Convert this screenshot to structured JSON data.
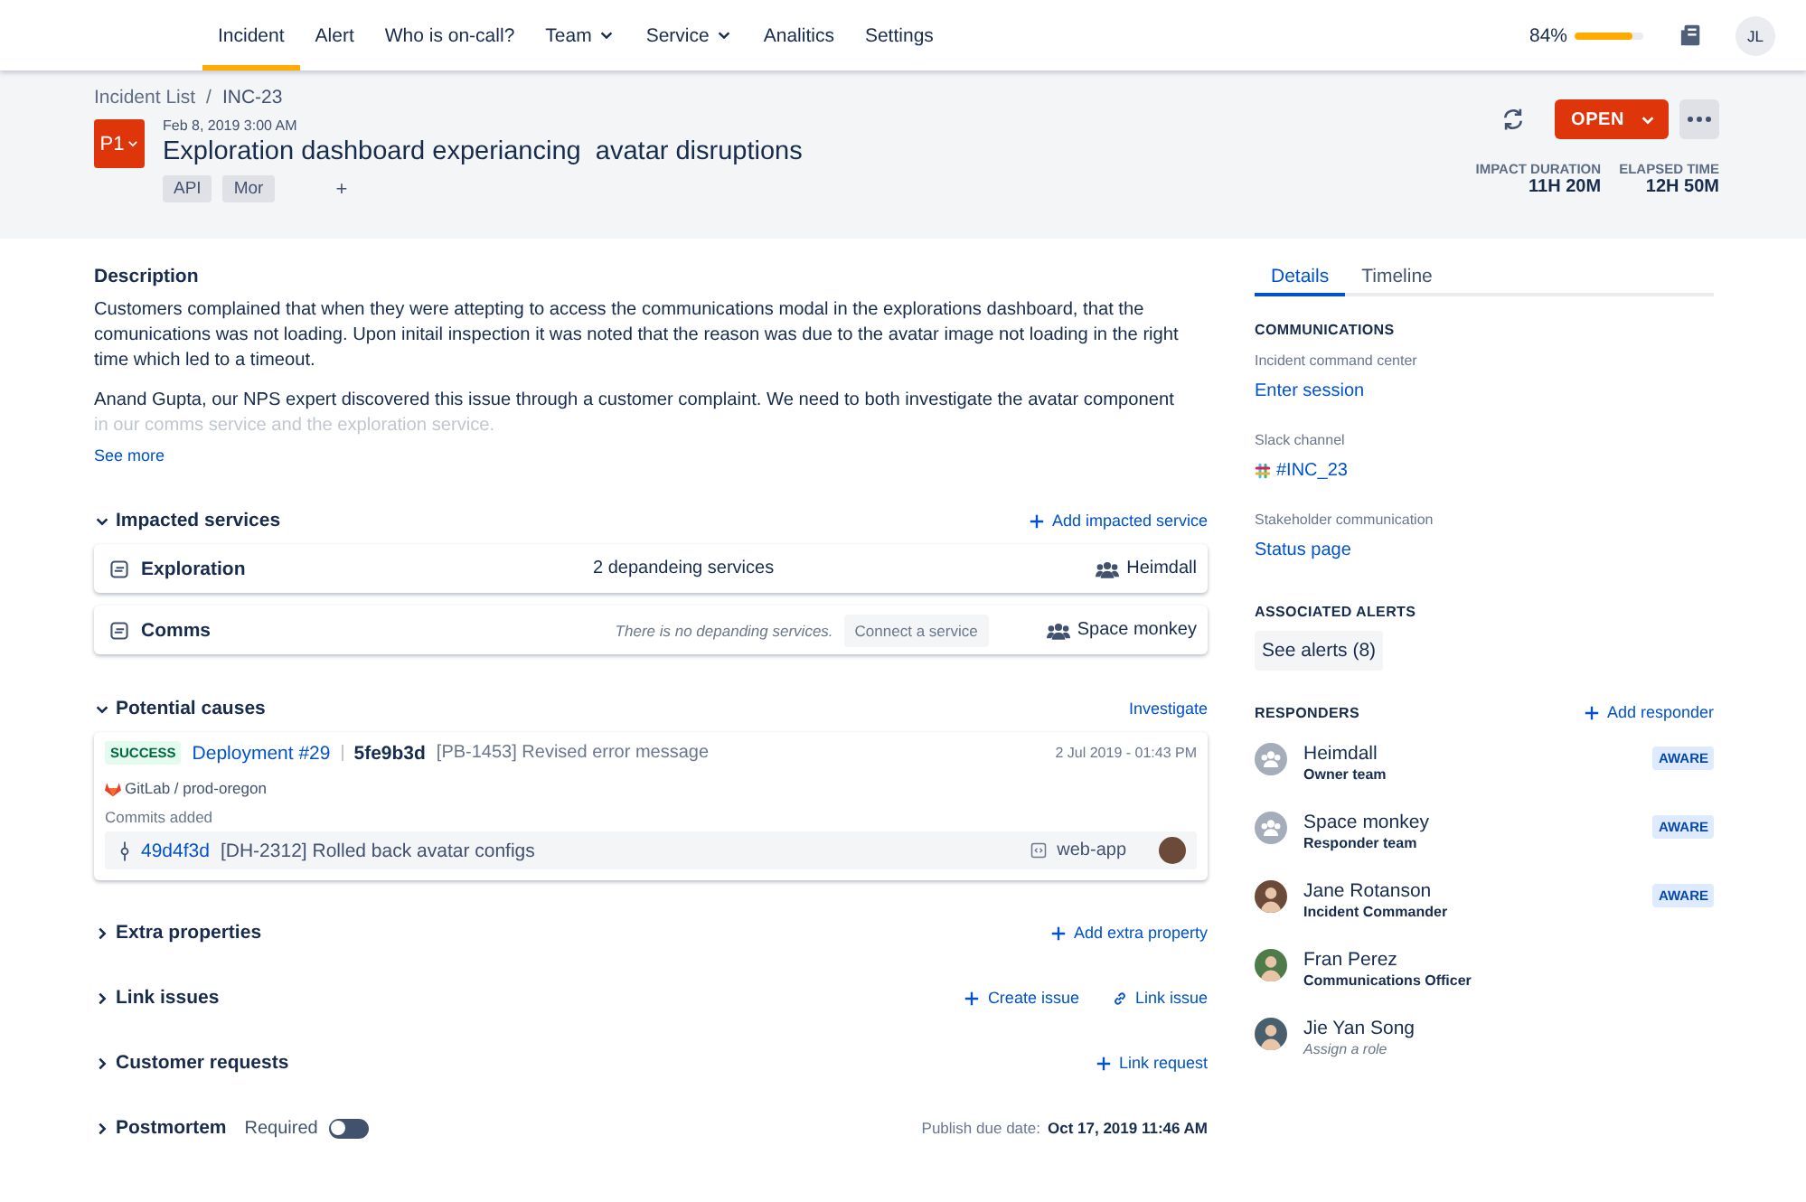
{
  "nav": {
    "items": [
      {
        "label": "Incident",
        "selected": true,
        "dropdown": false
      },
      {
        "label": "Alert",
        "selected": false,
        "dropdown": false
      },
      {
        "label": "Who is on-call?",
        "selected": false,
        "dropdown": false
      },
      {
        "label": "Team",
        "selected": false,
        "dropdown": true
      },
      {
        "label": "Service",
        "selected": false,
        "dropdown": true
      },
      {
        "label": "Analitics",
        "selected": false,
        "dropdown": false
      },
      {
        "label": "Settings",
        "selected": false,
        "dropdown": false
      }
    ],
    "usage": {
      "reading": "84%",
      "level": 0.84
    },
    "user_initials": "JL"
  },
  "header": {
    "breadcrumb": [
      "Incident List",
      "/",
      "INC-23"
    ],
    "priority": "P1",
    "date": "Feb 8, 2019 3:00 AM",
    "title": "Exploration dashboard experiancing  avatar disruptions",
    "tags": [
      "API",
      "Mor"
    ],
    "add_tag": "+",
    "status": "OPEN",
    "metrics": [
      {
        "label": "IMPACT DURATION",
        "value": "11H 20M"
      },
      {
        "label": "ELAPSED TIME",
        "value": "12H 50M"
      }
    ]
  },
  "description": {
    "title": "Description",
    "paragraphs": [
      {
        "text": "Customers complained that when they were attepting to access the communications modal in the explorations dashboard, that the comunications was not loading. Upon initail inspection it was noted that the reason was due to the avatar image not loading in the right time which led to a timeout."
      },
      {
        "text": "Anand Gupta, our NPS expert discovered this issue through a customer complaint. We need to both investigate the avatar component",
        "faded": "in our comms service and the exploration service."
      }
    ],
    "see_more": "See more"
  },
  "impacted_services": {
    "title": "Impacted services",
    "expanded": true,
    "action": "Add impacted service",
    "services": [
      {
        "name": "Exploration",
        "dependents": "2 depandeing services",
        "empty": false,
        "team": "Heimdall"
      },
      {
        "name": "Comms",
        "dependents": "There is no depanding services.",
        "empty": true,
        "connect": "Connect a service",
        "team": "Space monkey"
      }
    ]
  },
  "potential_causes": {
    "title": "Potential causes",
    "expanded": true,
    "action": "Investigate",
    "deployment": {
      "status": "SUCCESS",
      "name": "Deployment #29",
      "commit": "5fe9b3d",
      "message": "[PB-1453] Revised error message",
      "time": "2 Jul 2019 - 01:43 PM",
      "source": "GitLab / prod-oregon",
      "commits_label": "Commits added",
      "commits": [
        {
          "hash": "49d4f3d",
          "message": "[DH-2312] Rolled back avatar configs",
          "repo": "web-app"
        }
      ]
    }
  },
  "sections": [
    {
      "title": "Extra properties",
      "expanded": false,
      "actions": [
        {
          "kind": "add",
          "label": "Add extra property"
        }
      ]
    },
    {
      "title": "Link issues",
      "expanded": false,
      "actions": [
        {
          "kind": "add",
          "label": "Create issue"
        },
        {
          "kind": "link",
          "label": "Link issue"
        }
      ]
    },
    {
      "title": "Customer requests",
      "expanded": false,
      "actions": [
        {
          "kind": "add",
          "label": "Link request"
        }
      ]
    }
  ],
  "postmortem": {
    "title": "Postmortem",
    "expanded": false,
    "required_label": "Required",
    "on": false,
    "due_label": "Publish due date:",
    "due": "Oct 17, 2019 11:46 AM"
  },
  "sidebar": {
    "tabs": [
      {
        "label": "Details",
        "selected": true
      },
      {
        "label": "Timeline",
        "selected": false
      }
    ],
    "communications": {
      "title": "COMMUNICATIONS",
      "items": [
        {
          "kind": "link",
          "label": "Incident command center",
          "value": "Enter session"
        },
        {
          "kind": "slack",
          "label": "Slack channel",
          "value": "#INC_23"
        },
        {
          "kind": "link",
          "label": "Stakeholder communication",
          "value": "Status page"
        }
      ]
    },
    "alerts": {
      "title": "ASSOCIATED ALERTS",
      "button": "See alerts (8)"
    },
    "responders": {
      "title": "RESPONDERS",
      "action": "Add responder",
      "items": [
        {
          "kind": "team",
          "name": "Heimdall",
          "role": "Owner team",
          "assigned": true,
          "badge": "AWARE"
        },
        {
          "kind": "team",
          "name": "Space monkey",
          "role": "Responder team",
          "assigned": true,
          "badge": "AWARE"
        },
        {
          "kind": "person",
          "name": "Jane Rotanson",
          "role": "Incident Commander",
          "assigned": true,
          "badge": "AWARE",
          "color": "#6b4a3a"
        },
        {
          "kind": "person",
          "name": "Fran Perez",
          "role": "Communications Officer",
          "assigned": true,
          "color": "#4f7a4a"
        },
        {
          "kind": "person",
          "name": "Jie Yan Song",
          "role": "Assign a role",
          "assigned": false,
          "color": "#4a5f6e"
        }
      ]
    }
  }
}
